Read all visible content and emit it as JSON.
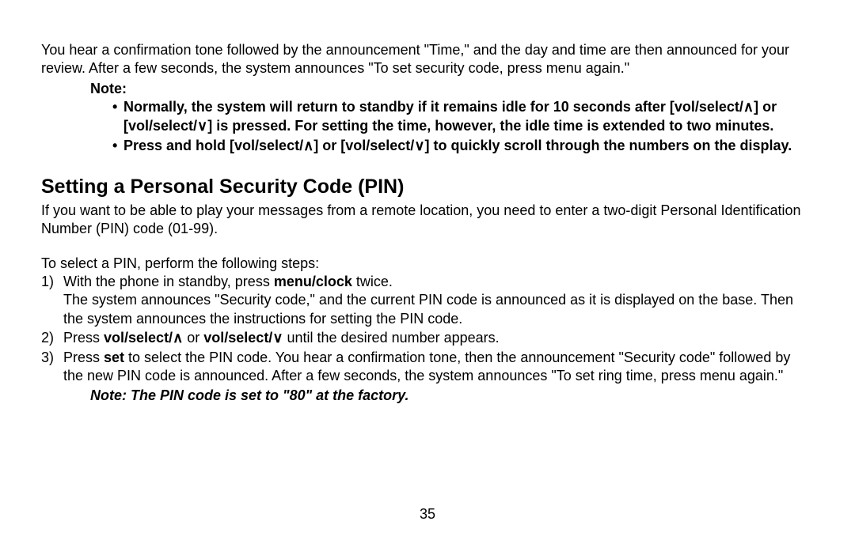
{
  "intro": {
    "p1": "You hear a confirmation tone followed by the announcement \"Time,\" and the day and time are then announced for your review. After a few seconds, the system announces \"To set security code, press menu again.\""
  },
  "note": {
    "label": "Note:",
    "bullets": [
      {
        "pre": "Normally, the system will return to standby if it remains idle for 10 seconds after [vol/select/",
        "up": "∧",
        "mid": "] or [vol/select/",
        "down": "∨",
        "post": "] is pressed. For setting the time, however, the idle time is extended to two minutes."
      },
      {
        "pre": "Press and hold [vol/select/",
        "up": "∧",
        "mid": "] or [vol/select/",
        "down": "∨",
        "post": "] to quickly scroll through the numbers on the display."
      }
    ]
  },
  "section": {
    "heading": "Setting a Personal Security Code (PIN)",
    "p1": "If you want to be able to play your messages from a remote location, you need to enter a two-digit Personal Identification Number (PIN) code (01-99).",
    "p2": "To select a PIN, perform the following steps:",
    "steps": [
      {
        "t1": "With the phone in standby, press ",
        "b1": "menu/clock",
        "t2": " twice.",
        "cont": "The system announces \"Security code,\" and the current PIN code is announced as it is displayed on the base. Then the system announces the instructions for setting the PIN code."
      },
      {
        "t1": "Press ",
        "b1": "vol/select/",
        "up": "∧",
        "t2": " or ",
        "b2": "vol/select/",
        "down": "∨",
        "t3": " until the desired number appears."
      },
      {
        "t1": "Press ",
        "b1": "set",
        "t2": " to select the PIN code. You hear a confirmation tone, then the announcement \"Security code\" followed by the new PIN code is announced. After a few seconds, the system announces \"To set ring time, press menu again.\""
      }
    ],
    "factory_note": "Note: The PIN code is set to \"80\" at the factory."
  },
  "page_number": "35"
}
